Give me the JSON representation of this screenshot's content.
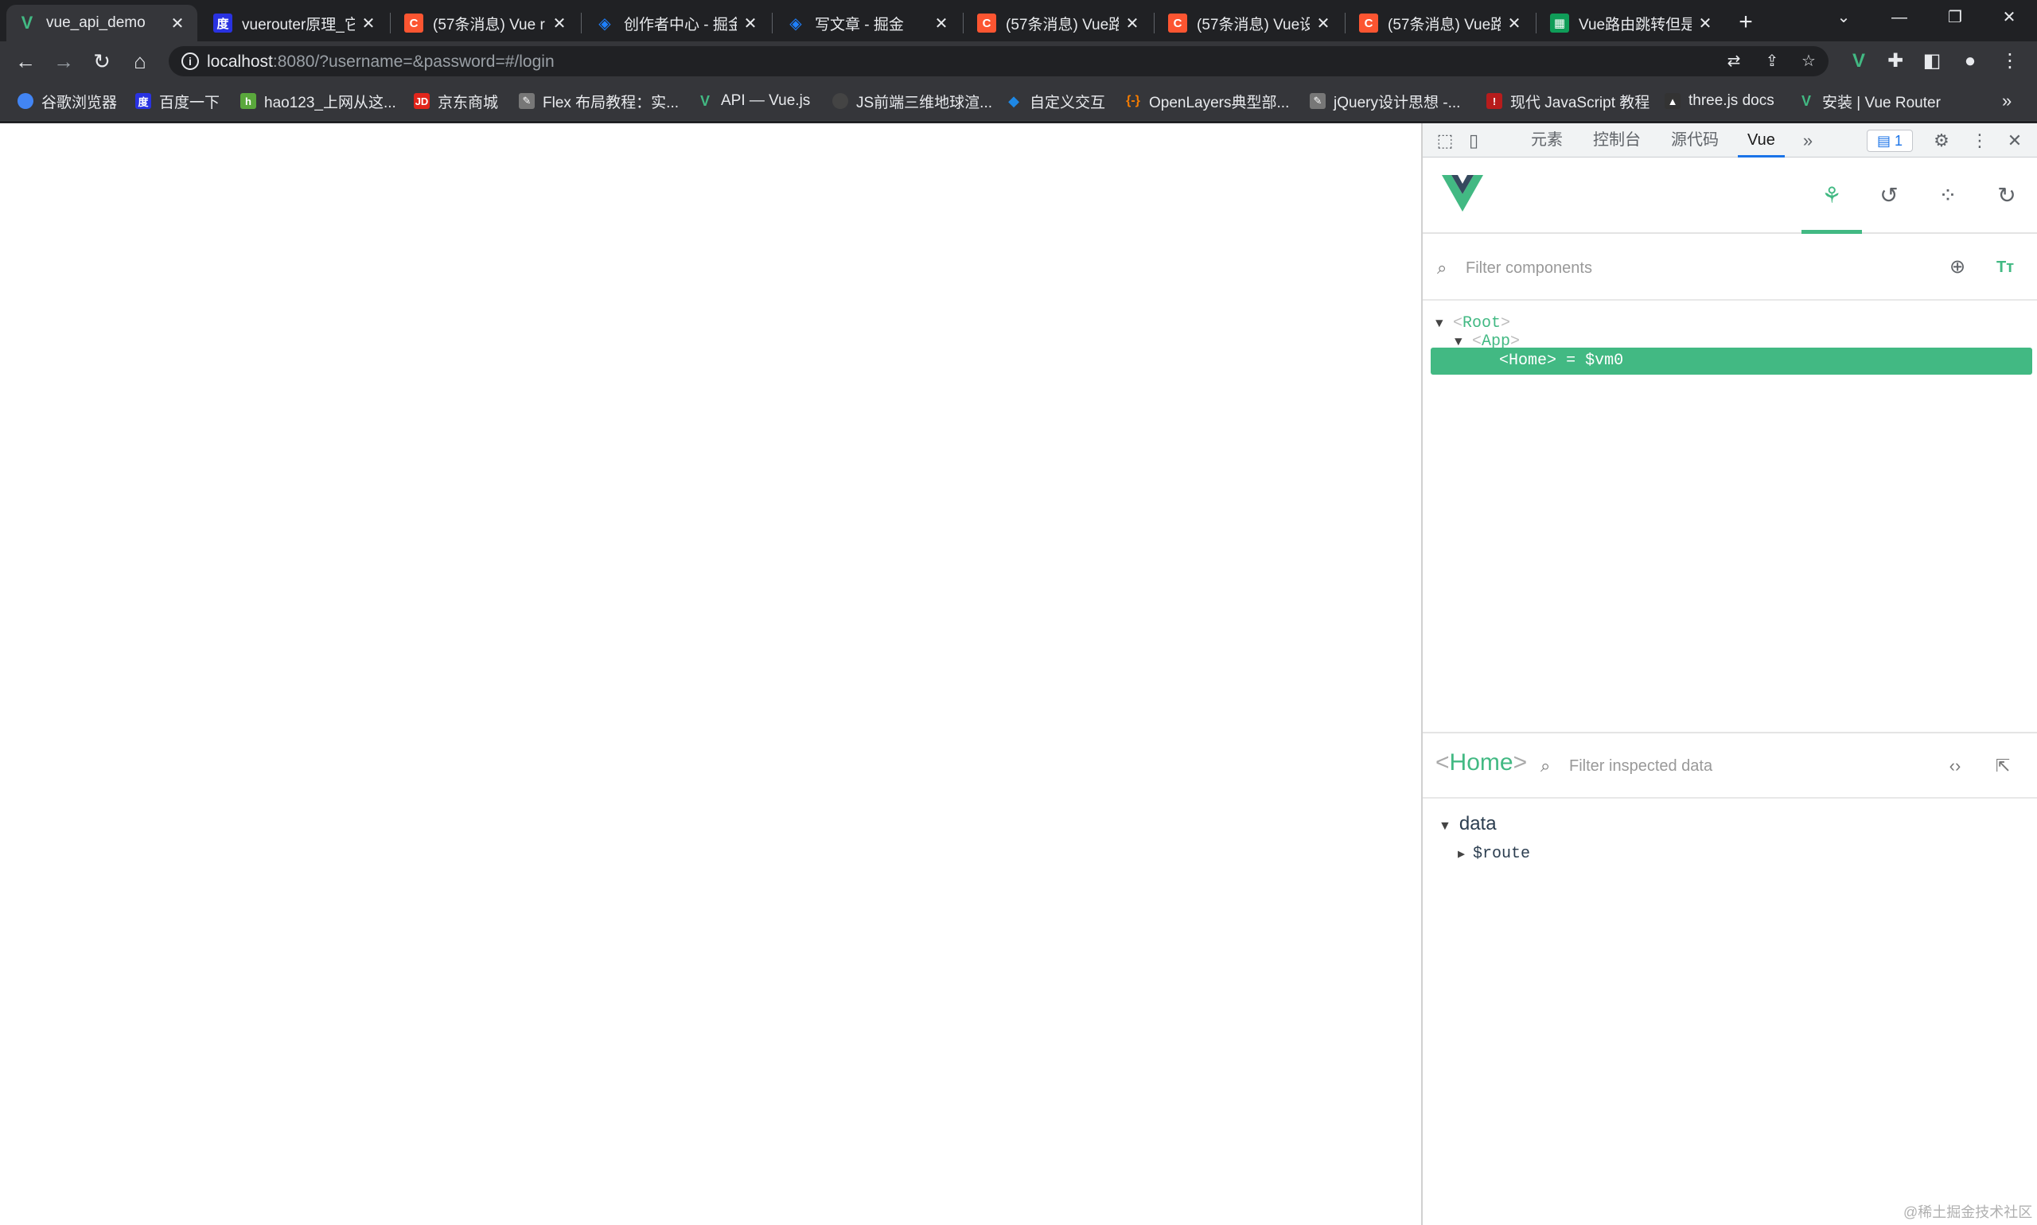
{
  "tabs": [
    {
      "title": "vue_api_demo",
      "icon": "vue-icon",
      "color": "#42b983"
    },
    {
      "title": "vuerouter原理_它",
      "icon": "baidu-icon",
      "color": "#2932e1"
    },
    {
      "title": "(57条消息) Vue r",
      "icon": "csdn-icon",
      "color": "#fc5531"
    },
    {
      "title": "创作者中心 - 掘金",
      "icon": "juejin-icon",
      "color": "#1e80ff"
    },
    {
      "title": "写文章 - 掘金",
      "icon": "juejin-icon",
      "color": "#1e80ff"
    },
    {
      "title": "(57条消息) Vue路",
      "icon": "csdn-icon",
      "color": "#fc5531"
    },
    {
      "title": "(57条消息) Vue设",
      "icon": "csdn-icon",
      "color": "#fc5531"
    },
    {
      "title": "(57条消息) Vue路",
      "icon": "csdn-icon",
      "color": "#fc5531"
    },
    {
      "title": "Vue路由跳转但是",
      "icon": "page-icon",
      "color": "#0f9d58"
    }
  ],
  "address": {
    "host": "localhost",
    "rest": ":8080/?username=&password=#/login"
  },
  "bookmarks": [
    {
      "label": "谷歌浏览器",
      "icon": "chrome-icon",
      "color": "#4285f4"
    },
    {
      "label": "百度一下",
      "icon": "baidu-icon",
      "color": "#2932e1"
    },
    {
      "label": "hao123_上网从这...",
      "icon": "hao123-icon",
      "color": "#5aa83c"
    },
    {
      "label": "京东商城",
      "icon": "jd-icon",
      "color": "#e1251b"
    },
    {
      "label": "Flex 布局教程：实...",
      "icon": "ruanyifeng-icon",
      "color": "#777777"
    },
    {
      "label": "API — Vue.js",
      "icon": "vue-icon",
      "color": "#42b983"
    },
    {
      "label": "JS前端三维地球渲...",
      "icon": "github-icon",
      "color": "#444444"
    },
    {
      "label": "自定义交互",
      "icon": "openlayers-icon",
      "color": "#1e88e5"
    },
    {
      "label": "OpenLayers典型部...",
      "icon": "code-icon",
      "color": "#f57c00"
    },
    {
      "label": "jQuery设计思想 -...",
      "icon": "ruanyifeng-icon",
      "color": "#777777"
    },
    {
      "label": "现代 JavaScript 教程",
      "icon": "js-info-icon",
      "color": "#b71c1c"
    },
    {
      "label": "three.js docs",
      "icon": "threejs-icon",
      "color": "#333333"
    },
    {
      "label": "安装 | Vue Router",
      "icon": "vue-icon",
      "color": "#42b983"
    }
  ],
  "devtools": {
    "tabs": {
      "elements": "元素",
      "console": "控制台",
      "sources": "源代码",
      "vue": "Vue"
    },
    "issues_count": "1",
    "filter_placeholder": "Filter components",
    "tree": {
      "root": "Root",
      "app": "App",
      "home": "Home",
      "home_vm": "= $vm0"
    },
    "inspector": {
      "title": "Home",
      "filter_placeholder": "Filter inspected data",
      "section": "data",
      "prop": "$route"
    }
  },
  "watermark": "@稀土掘金技术社区",
  "colors": {
    "vue_green": "#42b983",
    "chrome_dark": "#202124",
    "toolbar": "#35363a"
  }
}
